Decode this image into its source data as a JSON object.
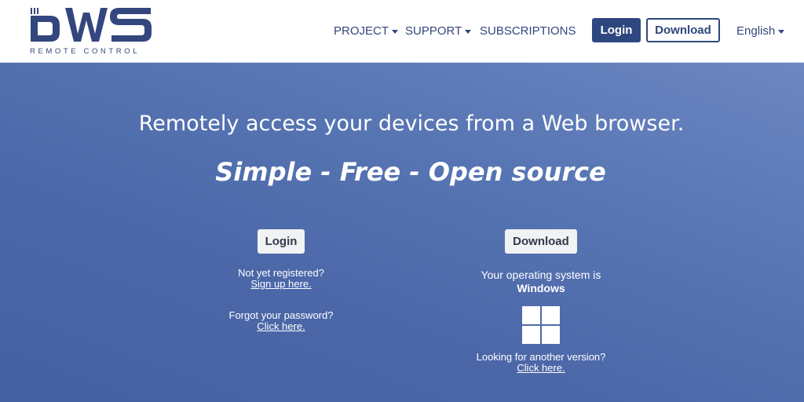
{
  "brand": {
    "logo_text": "DWS",
    "subtitle": "REMOTE CONTROL"
  },
  "nav": {
    "project": "PROJECT",
    "support": "SUPPORT",
    "subscriptions": "SUBSCRIPTIONS",
    "login": "Login",
    "download": "Download",
    "language": "English"
  },
  "hero": {
    "title": "Remotely access your devices from a Web browser.",
    "tagline": "Simple - Free - Open source",
    "login_button": "Login",
    "not_registered": "Not yet registered?",
    "signup_link": "Sign up here.",
    "forgot_password": "Forgot your password?",
    "forgot_link": "Click here.",
    "download_button": "Download",
    "os_label": "Your operating system is",
    "os_name": "Windows",
    "os_icon": "windows-icon",
    "other_version": "Looking for another version?",
    "other_link": "Click here."
  },
  "colors": {
    "brand": "#2f4780",
    "hero_gradient_light": "#6c87c2",
    "hero_gradient_dark": "#4561a2",
    "button_light": "#f1f2f4"
  }
}
